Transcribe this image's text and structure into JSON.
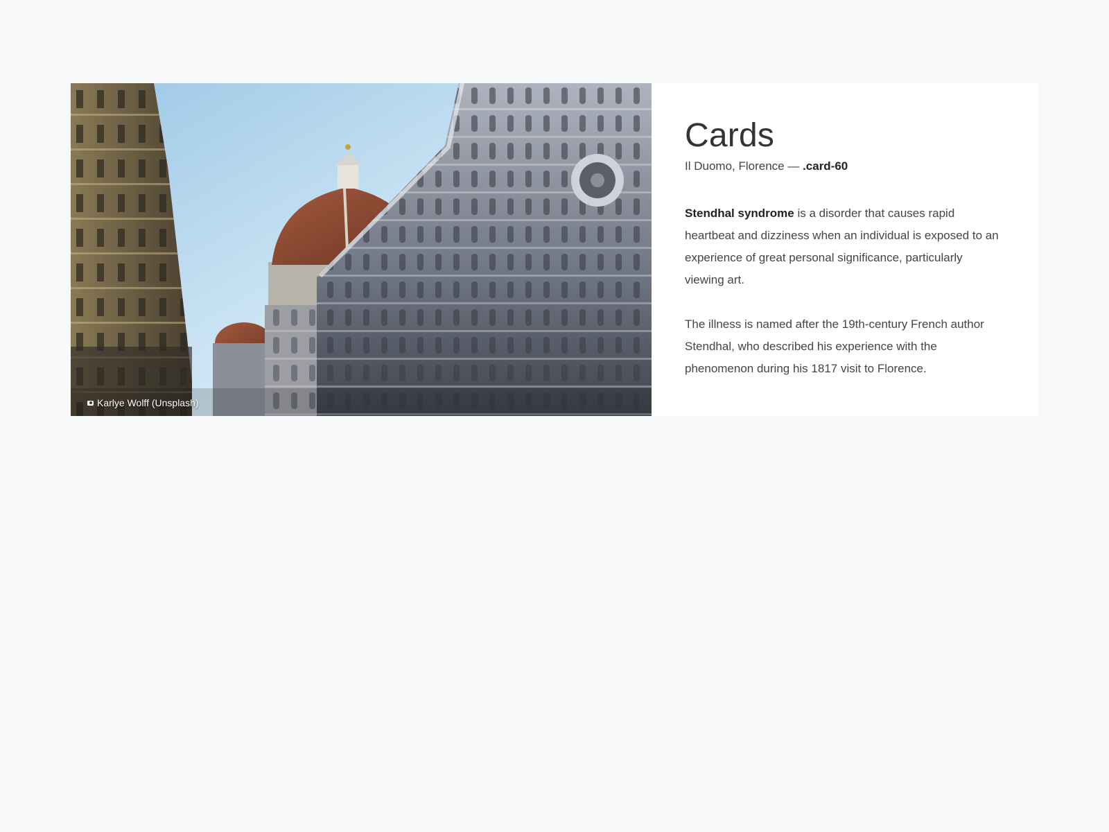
{
  "card": {
    "image": {
      "credit": "Karlye Wolff (Unsplash)",
      "credit_icon": "camera-icon",
      "subject": "Il Duomo, Florence cathedral photograph"
    },
    "title": "Cards",
    "subtitle_text": "Il Duomo, Florence — ",
    "subtitle_code": ".card-60",
    "paragraphs": [
      {
        "bold": "Stendhal syndrome",
        "text": " is a disorder that causes rapid heartbeat and dizziness when an individual is exposed to an experience of great personal significance, particularly viewing art."
      },
      {
        "text": "The illness is named after the 19th-century French author Stendhal, who described his experience with the phenomenon during his 1817 visit to Florence."
      }
    ]
  },
  "colors": {
    "page_background": "#f7f8fa",
    "card_background": "#ffffff",
    "text": "#333333"
  }
}
